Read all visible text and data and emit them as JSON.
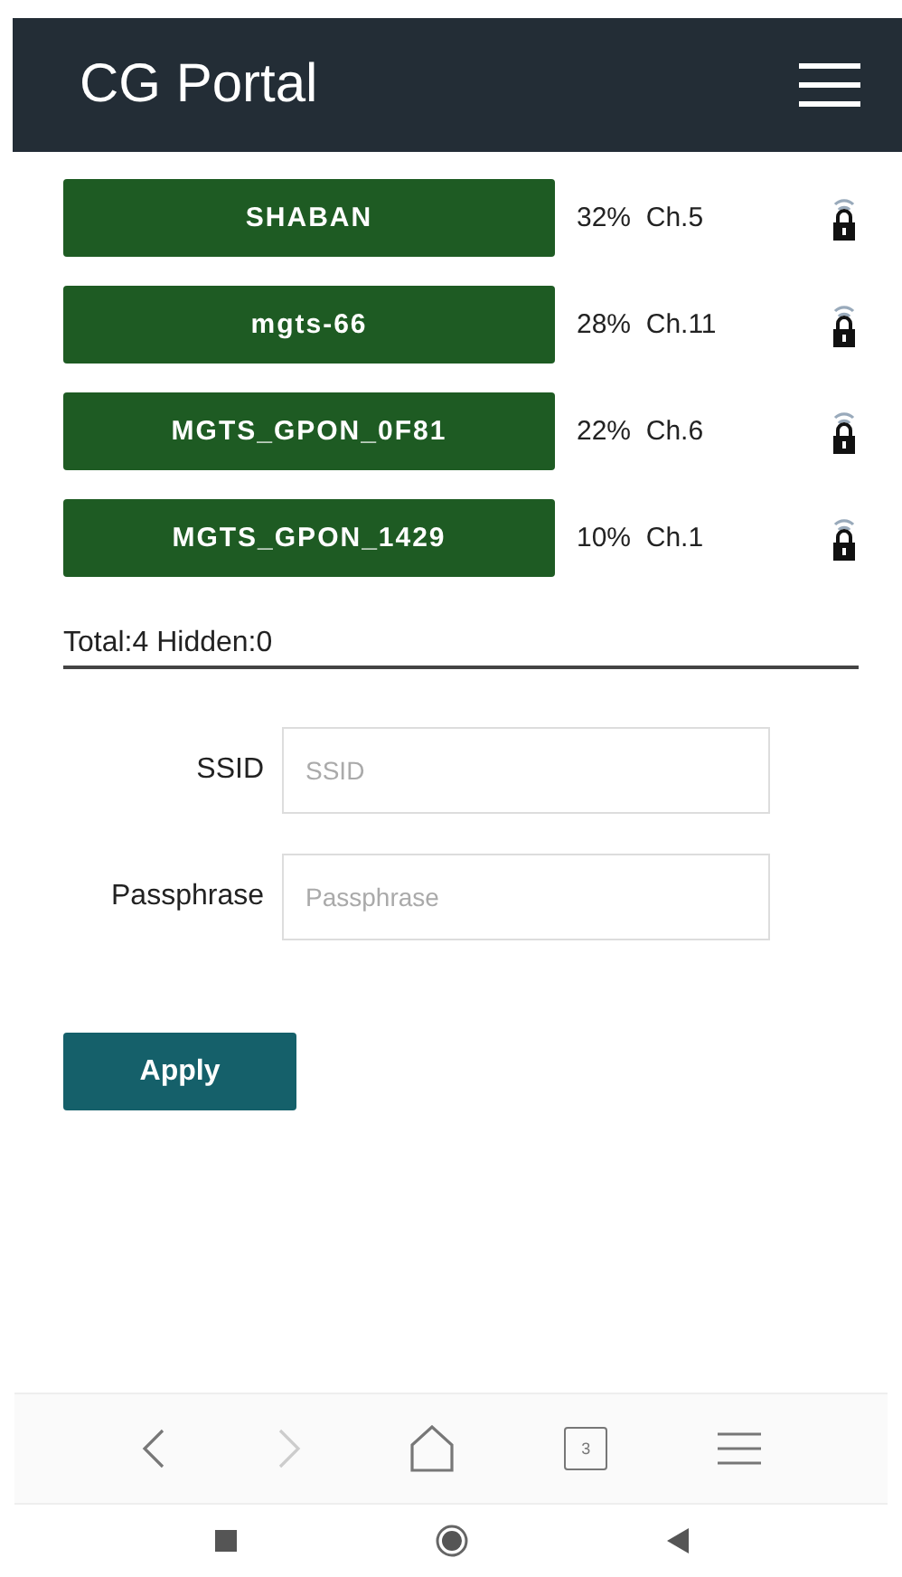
{
  "header": {
    "title": "CG Portal"
  },
  "networks": [
    {
      "ssid": "SHABAN",
      "signal": "32%",
      "channel": "Ch.5",
      "secured": true
    },
    {
      "ssid": "mgts-66",
      "signal": "28%",
      "channel": "Ch.11",
      "secured": true
    },
    {
      "ssid": "MGTS_GPON_0F81",
      "signal": "22%",
      "channel": "Ch.6",
      "secured": true
    },
    {
      "ssid": "MGTS_GPON_1429",
      "signal": "10%",
      "channel": "Ch.1",
      "secured": true
    }
  ],
  "summary": "Total:4 Hidden:0",
  "form": {
    "fields": [
      {
        "label": "SSID",
        "placeholder": "SSID"
      },
      {
        "label": "Passphrase",
        "placeholder": "Passphrase"
      }
    ],
    "apply": "Apply"
  },
  "browser_toolbar": {
    "back_disabled": false,
    "forward_disabled": true,
    "tab_count": "3"
  }
}
